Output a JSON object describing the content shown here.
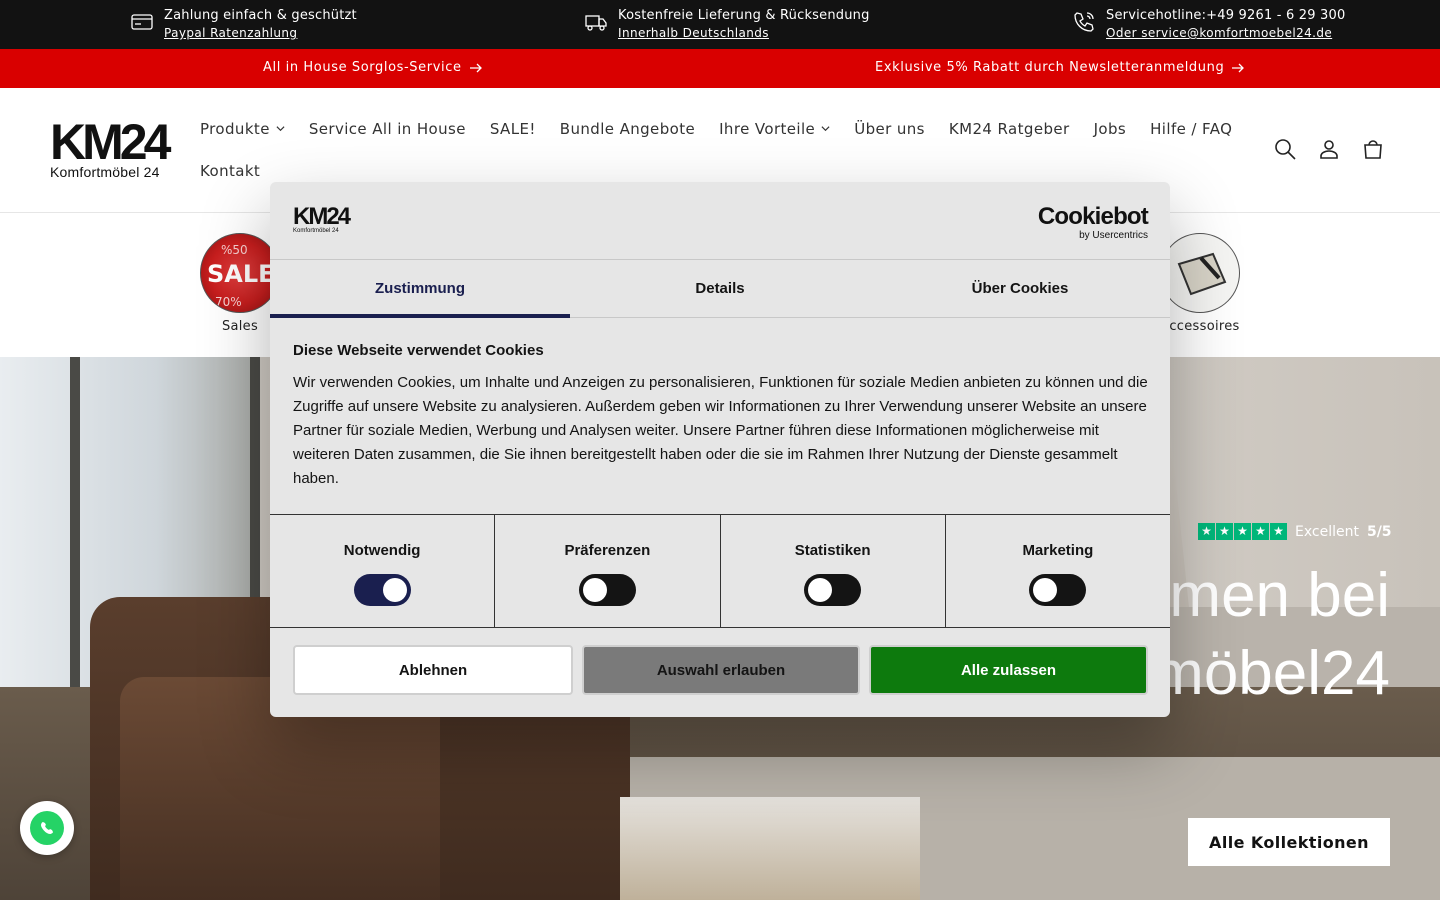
{
  "infobar": {
    "items": [
      {
        "title": "Zahlung einfach & geschützt",
        "link": "Paypal Ratenzahlung",
        "icon": "payment-card-icon"
      },
      {
        "title": "Kostenfreie Lieferung & Rücksendung",
        "link": "Innerhalb Deutschlands",
        "icon": "delivery-truck-icon"
      },
      {
        "title": "Servicehotline:+49 9261 - 6 29 300",
        "link": "Oder service@komfortmoebel24.de",
        "icon": "phone-icon"
      }
    ]
  },
  "announcements": [
    "All in House Sorglos-Service",
    "Exklusive 5% Rabatt durch Newsletteranmeldung"
  ],
  "header": {
    "logo_mark": "KM24",
    "logo_sub": "Komfortmöbel 24",
    "nav_row1": [
      {
        "label": "Produkte",
        "dropdown": true
      },
      {
        "label": "Service All in House",
        "dropdown": false
      },
      {
        "label": "SALE!",
        "dropdown": false
      },
      {
        "label": "Bundle Angebote",
        "dropdown": false
      },
      {
        "label": "Ihre Vorteile",
        "dropdown": true
      },
      {
        "label": "Über uns",
        "dropdown": false
      },
      {
        "label": "KM24 Ratgeber",
        "dropdown": false
      },
      {
        "label": "Jobs",
        "dropdown": false
      },
      {
        "label": "Hilfe / FAQ",
        "dropdown": false
      }
    ],
    "nav_row2": [
      {
        "label": "Kontakt",
        "dropdown": false
      }
    ],
    "icons": [
      "search-icon",
      "account-icon",
      "cart-icon"
    ]
  },
  "categories": [
    {
      "label": "Sales"
    },
    {
      "label": "Accessoires"
    }
  ],
  "hero": {
    "trust_label": "Excellent",
    "trust_score": "5/5",
    "title_line1": "men bei",
    "title_line2": "möbel24",
    "button": "Alle Kollektionen"
  },
  "cookie": {
    "logo_mark": "KM24",
    "logo_sub": "Komfortmöbel 24",
    "provider": "Cookiebot",
    "provider_sub": "by Usercentrics",
    "tabs": [
      "Zustimmung",
      "Details",
      "Über Cookies"
    ],
    "active_tab": 0,
    "heading": "Diese Webseite verwendet Cookies",
    "text": "Wir verwenden Cookies, um Inhalte und Anzeigen zu personalisieren, Funktionen für soziale Medien anbieten zu können und die Zugriffe auf unsere Website zu analysieren. Außerdem geben wir Informationen zu Ihrer Verwendung unserer Website an unsere Partner für soziale Medien, Werbung und Analysen weiter. Unsere Partner führen diese Informationen möglicherweise mit weiteren Daten zusammen, die Sie ihnen bereitgestellt haben oder die sie im Rahmen Ihrer Nutzung der Dienste gesammelt haben.",
    "categories": [
      {
        "name": "Notwendig",
        "on": true
      },
      {
        "name": "Präferenzen",
        "on": false
      },
      {
        "name": "Statistiken",
        "on": false
      },
      {
        "name": "Marketing",
        "on": false
      }
    ],
    "buttons": {
      "decline": "Ablehnen",
      "allow_selection": "Auswahl erlauben",
      "allow_all": "Alle zulassen"
    }
  },
  "colors": {
    "infobar_bg": "#121212",
    "announcement_bg": "#d90000",
    "trustpilot_green": "#00b67a",
    "cookie_accent": "#1a1f4f",
    "accept_green": "#0d7a0d",
    "whatsapp_green": "#25d366"
  }
}
